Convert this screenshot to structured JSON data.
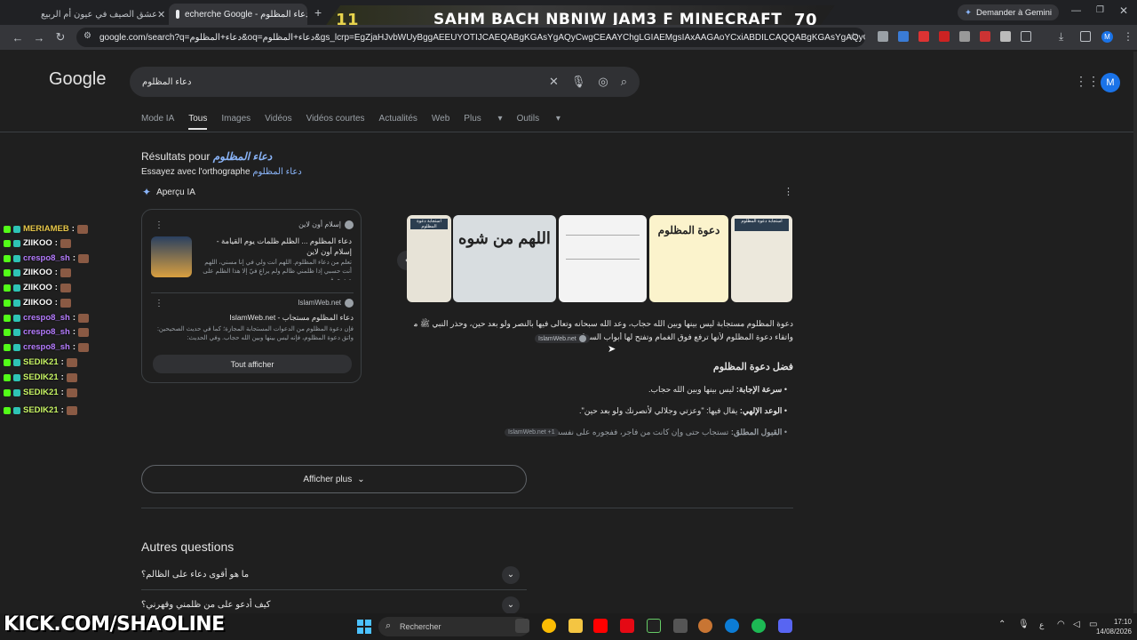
{
  "browser": {
    "tabs": [
      {
        "label": "عشق الصيف في عيون أم الربيع"
      },
      {
        "label": "echerche Google - دعاء المظلوم"
      }
    ],
    "gemini_label": "Demander à Gemini",
    "url": "google.com/search?q=دعاء+المظلوم&oq=دعاء+المظلوم&gs_lcrp=EgZjaHJvbWUyBggAEEUYOTIJCAEQABgKGAsYgAQyCwgCEAAYChgLGIAEMgsIAxAAGAoYCxiABDILCAQQABgKGAsYgAQyCwgFEAAYChg...",
    "profile_initial": "M"
  },
  "overlay": {
    "left_number": "11",
    "title": "SAHM BACH NBNIW JAM3 F MINECRAFT",
    "right_number": "70",
    "watermark": "KICK.COM/SHAOLINE"
  },
  "google": {
    "logo": "Google",
    "query": "دعاء المظلوم",
    "tabs": [
      "Mode IA",
      "Tous",
      "Images",
      "Vidéos",
      "Vidéos courtes",
      "Actualités",
      "Web",
      "Plus",
      "Outils"
    ],
    "results_for_prefix": "Résultats pour",
    "results_for_term": "دعاء المظلوم",
    "try_spelling_prefix": "Essayez avec l'orthographe",
    "try_spelling_term": "دعاء المظلوم",
    "ai_overview_label": "Aperçu IA",
    "sources": [
      {
        "site": "إسلام أون لاين",
        "title": "دعاء المظلوم ... الظلم ظلمات يوم القيامة - إسلام أون لاين",
        "snippet": "تعلم من دعاء المظلوم. اللهم أنت ولي في إنا مسني، اللهم أنت حسبي إذا ظلمني ظالم ولم يراعِ فيّ إلا هذا الظلم على صدري ف..."
      },
      {
        "site": "IslamWeb.net",
        "title": "دعاء المظلوم مستجاب - IslamWeb.net",
        "snippet": "فإن دعوة المظلوم من الدعوات المستجابة المجازة؛ كما في حديث الصحيحين: واتق دعوة المظلوم، فإنه ليس بينها وبين الله حجاب. وفي الحديث:"
      }
    ],
    "show_all_label": "Tout afficher",
    "image_texts": [
      "استجابة دعوة المظلوم",
      "اللهم من شوه",
      "",
      "دعوة المظلوم",
      "استجابة دعوة المظلوم"
    ],
    "ai_paragraph_1": "دعوة المظلوم مستجابة ليس بينها وبين الله حجاب، وعد الله سبحانه وتعالى فيها بالنصر ولو بعد حين، وحذر النبي ﷺ من الظلم",
    "ai_paragraph_2": "واتقاء دعوة المظلوم لأنها ترفع فوق الغمام وتفتح لها أبواب السماء.",
    "ai_paragraph_source": "IslamWeb.net",
    "section_heading": "فضل دعوة المظلوم",
    "bullets": [
      {
        "bold": "سرعة الإجابة:",
        "text": " ليس بينها وبين الله حجاب."
      },
      {
        "bold": "الوعد الإلهي:",
        "text": " يقال فيها: \"وعزتي وجلالي لأنصرنك ولو بعد حين\"."
      },
      {
        "bold": "القبول المطلق:",
        "text": " تستجاب حتى وإن كانت من فاجر، ففجوره على نفسه."
      }
    ],
    "bullet_source": "IslamWeb.net +1",
    "show_more_label": "Afficher plus",
    "other_questions_heading": "Autres questions",
    "questions": [
      "ما هو أقوى دعاء على الظالم؟",
      "كيف أدعو على من ظلمني وقهرني؟"
    ]
  },
  "chat": [
    {
      "user": "MERIAMEB",
      "color": "#e8c84a"
    },
    {
      "user": "ZIIKOO",
      "color": "#ffffff"
    },
    {
      "user": "crespo8_sh",
      "color": "#b57cff"
    },
    {
      "user": "ZIIKOO",
      "color": "#ffffff"
    },
    {
      "user": "ZIIKOO",
      "color": "#ffffff"
    },
    {
      "user": "ZIIKOO",
      "color": "#ffffff"
    },
    {
      "user": "crespo8_sh",
      "color": "#b57cff"
    },
    {
      "user": "crespo8_sh",
      "color": "#b57cff"
    },
    {
      "user": "crespo8_sh",
      "color": "#b57cff"
    },
    {
      "user": "SEDIK21",
      "color": "#c7f464"
    },
    {
      "user": "SEDIK21",
      "color": "#c7f464"
    },
    {
      "user": "SEDIK21",
      "color": "#c7f464"
    },
    {
      "user": "SEDIK21",
      "color": "#c7f464"
    }
  ],
  "taskbar": {
    "search_label": "Rechercher",
    "time": "17:10",
    "date": "14/08/2026",
    "lang": "ع"
  }
}
